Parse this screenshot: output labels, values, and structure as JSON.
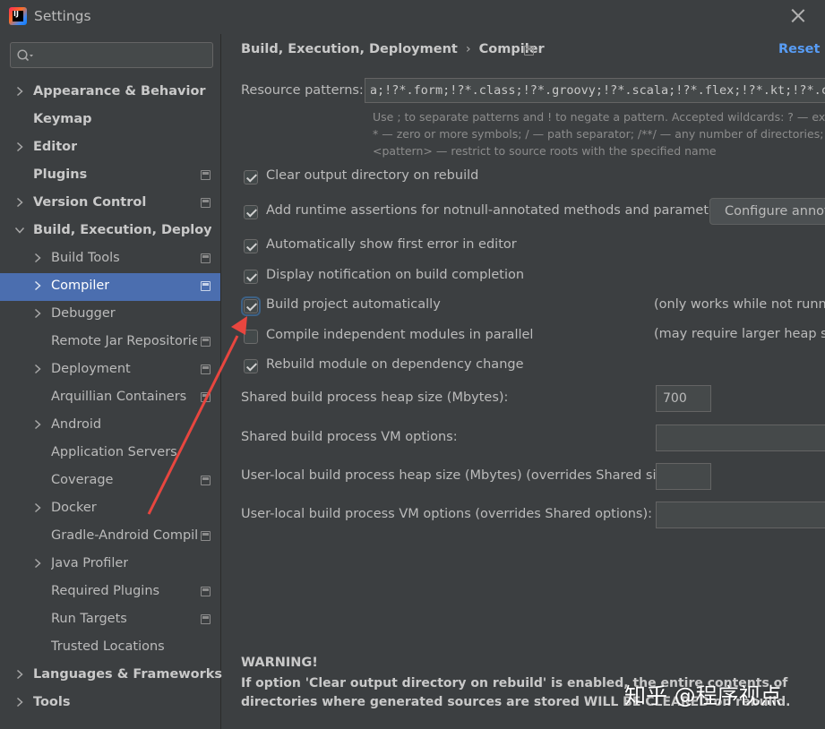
{
  "window": {
    "title": "Settings"
  },
  "search": {
    "placeholder": "",
    "value": ""
  },
  "sidebar": {
    "items": [
      {
        "label": "Appearance & Behavior"
      },
      {
        "label": "Keymap"
      },
      {
        "label": "Editor"
      },
      {
        "label": "Plugins"
      },
      {
        "label": "Version Control"
      },
      {
        "label": "Build, Execution, Deployment"
      },
      {
        "label": "Build Tools"
      },
      {
        "label": "Compiler"
      },
      {
        "label": "Debugger"
      },
      {
        "label": "Remote Jar Repositories"
      },
      {
        "label": "Deployment"
      },
      {
        "label": "Arquillian Containers"
      },
      {
        "label": "Android"
      },
      {
        "label": "Application Servers"
      },
      {
        "label": "Coverage"
      },
      {
        "label": "Docker"
      },
      {
        "label": "Gradle-Android Compiler"
      },
      {
        "label": "Java Profiler"
      },
      {
        "label": "Required Plugins"
      },
      {
        "label": "Run Targets"
      },
      {
        "label": "Trusted Locations"
      },
      {
        "label": "Languages & Frameworks"
      },
      {
        "label": "Tools"
      }
    ]
  },
  "header": {
    "breadcrumb_parent": "Build, Execution, Deployment",
    "breadcrumb_sep": "›",
    "breadcrumb_current": "Compiler",
    "reset_label": "Reset"
  },
  "resource_patterns": {
    "label": "Resource patterns:",
    "value": "!?*.java;!?*.form;!?*.class;!?*.groovy;!?*.scala;!?*.flex;!?*.kt;!?*.clj",
    "hint1": "Use ; to separate patterns and ! to negate a pattern. Accepted wildcards: ? — exactly one symbol;",
    "hint2": "* — zero or more symbols; / — path separator; /**/ — any number of directories;",
    "hint3": "<pattern> — restrict to source roots with the specified name"
  },
  "options": {
    "clear_output": {
      "label": "Clear output directory on rebuild",
      "checked": true
    },
    "runtime_assertions": {
      "label": "Add runtime assertions for notnull-annotated methods and parameters",
      "checked": true
    },
    "configure_button": "Configure annotations...",
    "show_first_error": {
      "label": "Automatically show first error in editor",
      "checked": true
    },
    "display_notification": {
      "label": "Display notification on build completion",
      "checked": true
    },
    "build_automatically": {
      "label": "Build project automatically",
      "checked": true,
      "note": "(only works while not running / debugging)"
    },
    "compile_parallel": {
      "label": "Compile independent modules in parallel",
      "checked": false,
      "note": "(may require larger heap size)"
    },
    "rebuild_on_dependency": {
      "label": "Rebuild module on dependency change",
      "checked": true
    }
  },
  "fields": {
    "shared_heap": {
      "label": "Shared build process heap size (Mbytes):",
      "value": "700"
    },
    "shared_vm": {
      "label": "Shared build process VM options:",
      "value": ""
    },
    "local_heap": {
      "label": "User-local build process heap size (Mbytes) (overrides Shared size):",
      "value": ""
    },
    "local_vm": {
      "label": "User-local build process VM options (overrides Shared options):",
      "value": ""
    }
  },
  "warning": {
    "title": "WARNING!",
    "text": "If option 'Clear output directory on rebuild' is enabled, the entire contents of directories where generated sources are stored WILL BE CLEARED on rebuild."
  },
  "annotation": {
    "arrow_color": "#e8463f"
  },
  "watermark": {
    "text": "知乎 @程序视点"
  },
  "colors": {
    "selection": "#4b6eaf",
    "link": "#589df6",
    "background": "#3c3f41"
  }
}
